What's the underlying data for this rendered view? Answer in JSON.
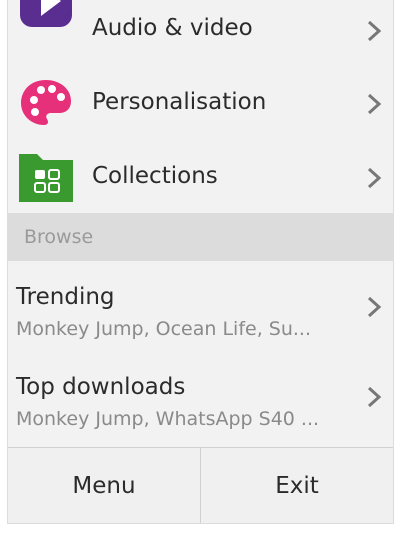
{
  "menu": {
    "items": [
      {
        "label": "Audio & video",
        "icon": "play-icon",
        "color": "#5a2d91"
      },
      {
        "label": "Personalisation",
        "icon": "palette-icon",
        "color": "#e6307a"
      },
      {
        "label": "Collections",
        "icon": "folder-icon",
        "color": "#3a9a2f"
      }
    ]
  },
  "browse": {
    "section_label": "Browse",
    "items": [
      {
        "title": "Trending",
        "subtitle": "Monkey Jump, Ocean Life, Su..."
      },
      {
        "title": "Top downloads",
        "subtitle": "Monkey Jump, WhatsApp S40 ..."
      }
    ]
  },
  "softkeys": {
    "left": "Menu",
    "right": "Exit"
  }
}
